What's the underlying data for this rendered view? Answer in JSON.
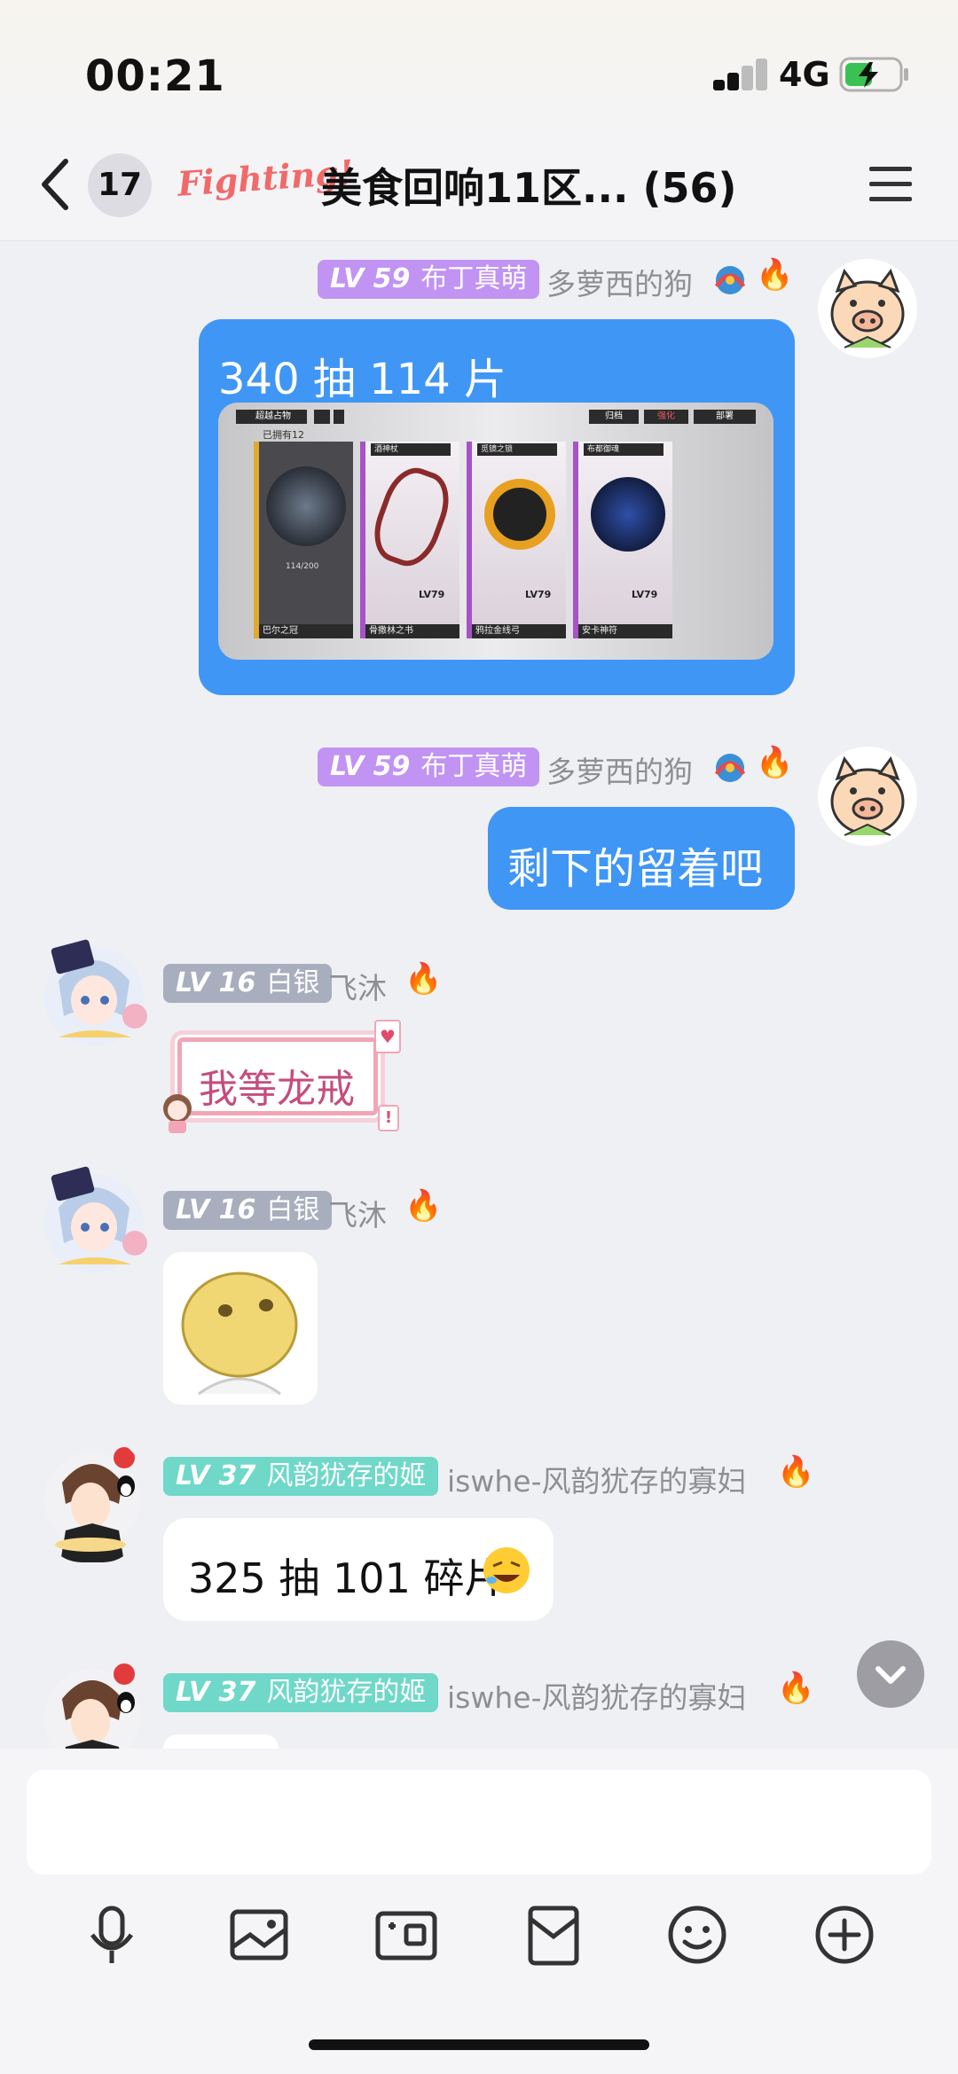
{
  "status_bar": {
    "time": "00:21",
    "network": "4G"
  },
  "header": {
    "unread_count": "17",
    "logo_text": "Fighting!",
    "title": "美食回响11区... (56)"
  },
  "messages": [
    {
      "level": "LV 59",
      "level_num": "59",
      "rank": "布丁真萌",
      "sender": "多萝西的狗",
      "text": "340 抽 114 片",
      "image_caption": "已拥有12"
    },
    {
      "level": "LV 59",
      "level_num": "59",
      "rank": "布丁真萌",
      "sender": "多萝西的狗",
      "text": "剩下的留着吧"
    },
    {
      "level": "LV 16",
      "level_num": "16",
      "rank": "白银",
      "sender": "飞沐",
      "sticker_text": "我等龙戒"
    },
    {
      "level": "LV 16",
      "level_num": "16",
      "rank": "白银",
      "sender": "飞沐"
    },
    {
      "level": "LV 37",
      "level_num": "37",
      "rank": "风韵犹存的姬",
      "sender": "iswhe-风韵犹存的寡妇",
      "text": "325 抽 101 碎片"
    },
    {
      "level": "LV 37",
      "level_num": "37",
      "rank": "风韵犹存的姬",
      "sender": "iswhe-风韵犹存的寡妇"
    }
  ],
  "game_screenshot": {
    "top_labels": [
      "超越占物",
      "归档",
      "强化",
      "部署"
    ],
    "cards": [
      {
        "name": "",
        "level": "",
        "label": "巴尔之冠",
        "progress": "114/200"
      },
      {
        "name": "酒神杖",
        "level": "LV79",
        "label": "骨撒林之书"
      },
      {
        "name": "觅镜之锁",
        "level": "LV79",
        "label": "鸦拉金线弓"
      },
      {
        "name": "布都御魂",
        "level": "LV79",
        "label": "安卡神符"
      }
    ]
  },
  "toolbar": [
    "microphone-icon",
    "image-icon",
    "camera-icon",
    "red-packet-icon",
    "emoji-icon",
    "plus-icon"
  ],
  "colors": {
    "accent_blue": "#4096f5",
    "badge_purple": "#c193f2",
    "badge_gray": "#a8aebd",
    "badge_teal": "#6fd8c9"
  }
}
